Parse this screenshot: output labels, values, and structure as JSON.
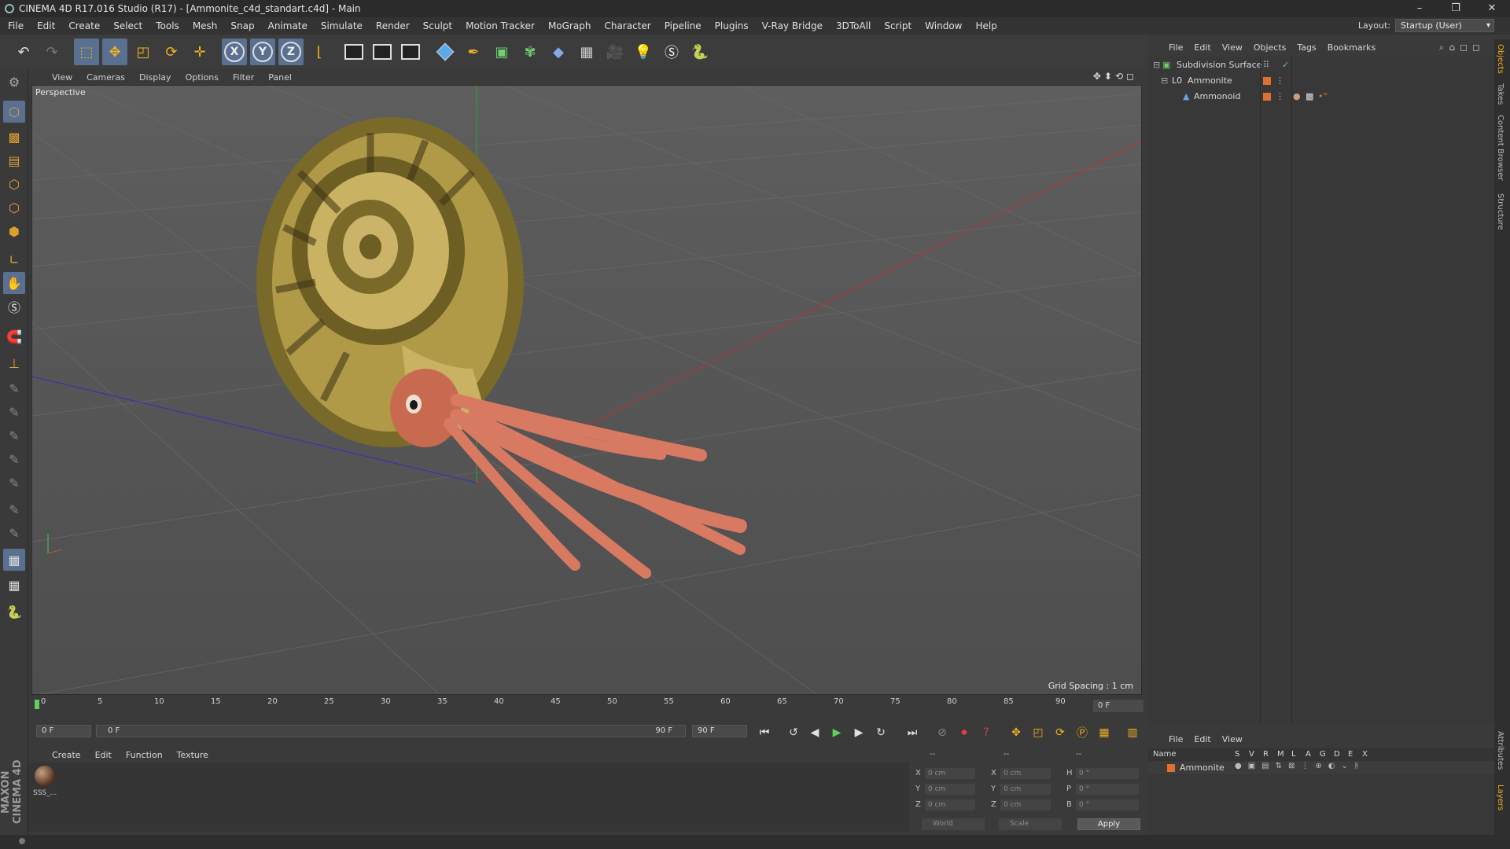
{
  "window": {
    "title": "CINEMA 4D R17.016 Studio (R17) - [Ammonite_c4d_standart.c4d] - Main",
    "controls": [
      "–",
      "❐",
      "✕"
    ]
  },
  "menubar": {
    "items": [
      "File",
      "Edit",
      "Create",
      "Select",
      "Tools",
      "Mesh",
      "Snap",
      "Animate",
      "Simulate",
      "Render",
      "Sculpt",
      "Motion Tracker",
      "MoGraph",
      "Character",
      "Pipeline",
      "Plugins",
      "V-Ray Bridge",
      "3DToAll",
      "Script",
      "Window",
      "Help"
    ],
    "layout_label": "Layout:",
    "layout_value": "Startup (User)"
  },
  "toolbar": {
    "axis_x": "X",
    "axis_y": "Y",
    "axis_z": "Z"
  },
  "viewport": {
    "menu": [
      "View",
      "Cameras",
      "Display",
      "Options",
      "Filter",
      "Panel"
    ],
    "label": "Perspective",
    "grid_spacing": "Grid Spacing : 1 cm"
  },
  "timeline": {
    "ticks": [
      "0",
      "5",
      "10",
      "15",
      "20",
      "25",
      "30",
      "35",
      "40",
      "45",
      "50",
      "55",
      "60",
      "65",
      "70",
      "75",
      "80",
      "85",
      "90"
    ],
    "current_frame": "0 F",
    "start_field": "0 F",
    "range_start": "0 F",
    "range_end": "90 F",
    "end_field": "90 F"
  },
  "material_manager": {
    "menu": [
      "Create",
      "Edit",
      "Function",
      "Texture"
    ],
    "material_name": "SSS_..."
  },
  "coordinates": {
    "header": [
      "--",
      "--",
      "--"
    ],
    "rows": [
      {
        "a": "X",
        "av": "0 cm",
        "b": "X",
        "bv": "0 cm",
        "c": "H",
        "cv": "0 °"
      },
      {
        "a": "Y",
        "av": "0 cm",
        "b": "Y",
        "bv": "0 cm",
        "c": "P",
        "cv": "0 °"
      },
      {
        "a": "Z",
        "av": "0 cm",
        "b": "Z",
        "bv": "0 cm",
        "c": "B",
        "cv": "0 °"
      }
    ],
    "mode_world": "World",
    "mode_scale": "Scale",
    "apply": "Apply"
  },
  "object_manager": {
    "menu": [
      "File",
      "Edit",
      "View",
      "Objects",
      "Tags",
      "Bookmarks"
    ],
    "objects": [
      {
        "name": "Subdivision Surface",
        "color": "#6fd06f"
      },
      {
        "name": "Ammonite",
        "color": "#d0d0d0"
      },
      {
        "name": "Ammonoid",
        "color": "#5fa8e8"
      }
    ]
  },
  "layers": {
    "menu": [
      "File",
      "Edit",
      "View"
    ],
    "columns": [
      "Name",
      "S",
      "V",
      "R",
      "M",
      "L",
      "A",
      "G",
      "D",
      "E",
      "X"
    ],
    "row_name": "Ammonite"
  },
  "right_tabs": [
    "Objects",
    "Takes",
    "Content Browser",
    "Structure",
    "Attributes",
    "Layers"
  ],
  "branding": "MAXON CINEMA 4D",
  "colors": {
    "accent_selected": "#5a7090",
    "tool_orange": "#f0b020",
    "layer_tag": "#e07030"
  }
}
